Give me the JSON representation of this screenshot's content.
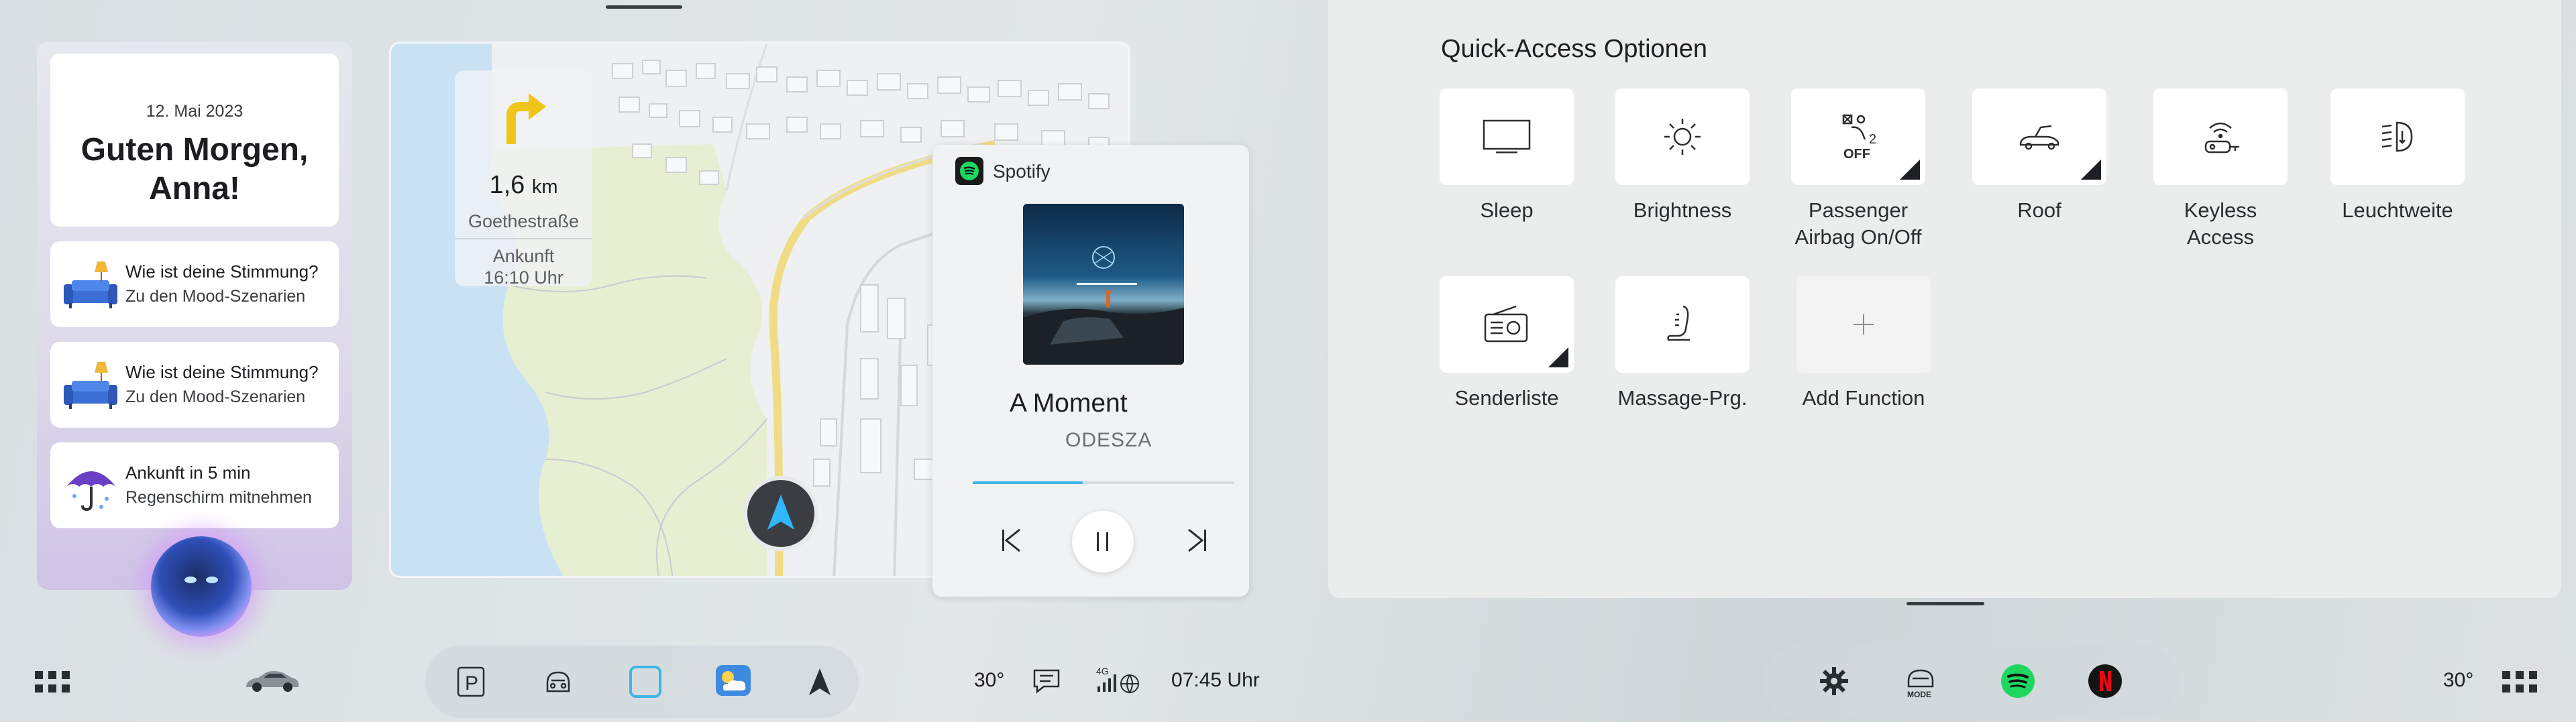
{
  "greeting": {
    "date": "12. Mai 2023",
    "line1": "Guten Morgen,",
    "line2": "Anna!"
  },
  "notifications": [
    {
      "title": "Wie ist deine Stimmung?",
      "subtitle": "Zu den Mood-Szenarien",
      "icon": "sofa-lamp-icon"
    },
    {
      "title": "Wie ist deine Stimmung?",
      "subtitle": "Zu den Mood-Szenarien",
      "icon": "sofa-lamp-icon"
    },
    {
      "title": "Ankunft in 5 min",
      "subtitle": "Regenschirm mitnehmen",
      "icon": "umbrella-icon"
    }
  ],
  "navigation": {
    "distance": "1,6",
    "unit": "km",
    "street": "Goethestraße",
    "arrival_label": "Ankunft",
    "arrival_time": "16:10 Uhr"
  },
  "spotify": {
    "app": "Spotify",
    "title": "A Moment",
    "artist": "ODESZA",
    "progress": 0.42
  },
  "quick_access": {
    "title": "Quick-Access Optionen",
    "tiles": [
      {
        "label": "Sleep",
        "icon": "monitor-icon",
        "corner": false
      },
      {
        "label": "Brightness",
        "icon": "sun-icon",
        "corner": false
      },
      {
        "label": "Passenger Airbag On/Off",
        "icon": "airbag-off-icon",
        "badge": "OFF",
        "badge_num": "2",
        "corner": true
      },
      {
        "label": "Roof",
        "icon": "convertible-roof-icon",
        "corner": true
      },
      {
        "label": "Keyless Access",
        "icon": "keyless-icon",
        "corner": false
      },
      {
        "label": "Leuchtweite",
        "icon": "headlight-range-icon",
        "corner": false
      },
      {
        "label": "Senderliste",
        "icon": "radio-icon",
        "corner": true
      },
      {
        "label": "Massage-Prg.",
        "icon": "massage-seat-icon",
        "corner": false
      },
      {
        "label": "Add Function",
        "icon": "plus-icon",
        "corner": false
      }
    ]
  },
  "bottom_bar": {
    "temp_left": "30°",
    "temp_right": "30°",
    "time": "07:45 Uhr",
    "signal": "4G",
    "mode_label": "MODE",
    "parking_label": "P"
  },
  "colors": {
    "accent": "#3fb6e6",
    "spotify_green": "#1ed760",
    "netflix_red": "#e50914",
    "route_yellow": "#f1dc86"
  }
}
